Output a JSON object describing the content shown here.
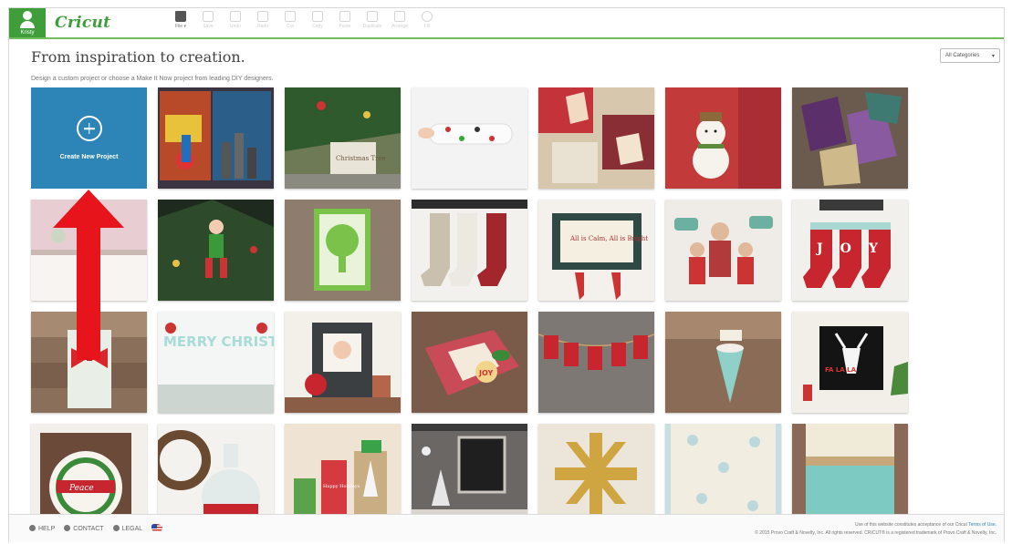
{
  "header": {
    "user_name": "Kristy",
    "logo": "Cricut",
    "tools": [
      {
        "label": "File ▾",
        "icon": "folder-icon",
        "active": true
      },
      {
        "label": "Save",
        "icon": "save-icon"
      },
      {
        "label": "Undo",
        "icon": "undo-icon"
      },
      {
        "label": "Redo",
        "icon": "redo-icon"
      },
      {
        "label": "Cut",
        "icon": "cut-icon"
      },
      {
        "label": "Copy",
        "icon": "copy-icon"
      },
      {
        "label": "Paste",
        "icon": "paste-icon"
      },
      {
        "label": "Duplicate",
        "icon": "duplicate-icon"
      },
      {
        "label": "Arrange",
        "icon": "arrange-icon"
      },
      {
        "label": "Fill",
        "icon": "fill-icon"
      }
    ]
  },
  "page": {
    "title": "From inspiration to creation.",
    "subtitle": "Design a custom project or choose a Make It Now project from leading DIY designers.",
    "category_select": "All Categories",
    "create_label": "Create New Project"
  },
  "colors": {
    "accent_green": "#3f9e3a",
    "create_blue": "#2d84b6",
    "arrow_red": "#e8141b"
  },
  "projects": [
    {
      "name": "superhero-collage",
      "text": ""
    },
    {
      "name": "christmas-tree-gift-tags",
      "text": "Christmas Tree"
    },
    {
      "name": "arm-warmer-sleeve",
      "text": ""
    },
    {
      "name": "gift-wrap-tags",
      "text": ""
    },
    {
      "name": "snowman-gift-tag",
      "text": ""
    },
    {
      "name": "geometric-pouches",
      "text": ""
    },
    {
      "name": "pink-wall-shelf",
      "text": ""
    },
    {
      "name": "elf-ornament-tree",
      "text": ""
    },
    {
      "name": "green-tree-card",
      "text": ""
    },
    {
      "name": "knit-stockings",
      "text": ""
    },
    {
      "name": "all-is-calm-frame",
      "text": "All is Calm, All is Bright"
    },
    {
      "name": "family-photo-props",
      "text": ""
    },
    {
      "name": "joy-stockings",
      "text": "JOY"
    },
    {
      "name": "wood-bow-gift",
      "text": ""
    },
    {
      "name": "merry-christmas-banner",
      "text": "MERRY CHRISTMAS"
    },
    {
      "name": "wood-photo-frame",
      "text": ""
    },
    {
      "name": "joy-gift-box",
      "text": "JOY"
    },
    {
      "name": "red-pennant-banner",
      "text": ""
    },
    {
      "name": "paper-cone-treat",
      "text": ""
    },
    {
      "name": "fa-la-la-reindeer",
      "text": "FA LA LA"
    },
    {
      "name": "peace-wreath-sign",
      "text": "Peace"
    },
    {
      "name": "glass-jug-wreath",
      "text": ""
    },
    {
      "name": "holiday-gift-bags",
      "text": "Happy Holidays"
    },
    {
      "name": "chalkboard-mantel",
      "text": ""
    },
    {
      "name": "gold-snowflake-mat",
      "text": ""
    },
    {
      "name": "snowflake-garland",
      "text": ""
    },
    {
      "name": "lace-gift-box",
      "text": ""
    }
  ],
  "footer": {
    "help": "HELP",
    "contact": "CONTACT",
    "legal": "LEGAL",
    "terms_line": "Use of this website constitutes acceptance of our Cricut",
    "terms_link": "Terms of Use.",
    "copyright": "© 2015 Provo Craft & Novelty, Inc. All rights reserved. CRICUT® is a registered trademark of Provo Craft & Novelty, Inc."
  }
}
